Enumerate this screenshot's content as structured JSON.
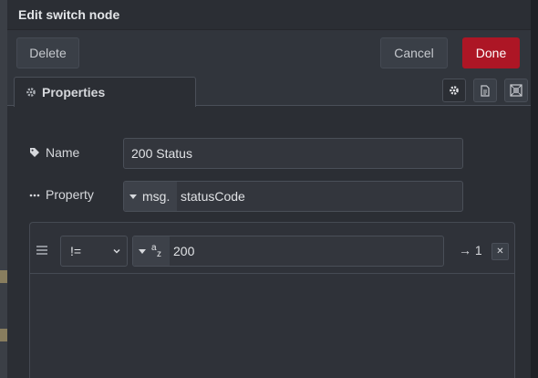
{
  "tray": {
    "title": "Edit switch node"
  },
  "toolbar": {
    "delete_label": "Delete",
    "cancel_label": "Cancel",
    "done_label": "Done"
  },
  "tabs": {
    "properties": {
      "label": "Properties",
      "icon": "gear-icon"
    },
    "icons": [
      "gear-icon",
      "document-icon",
      "frame-icon"
    ]
  },
  "form": {
    "name": {
      "label": "Name",
      "icon": "tag-icon",
      "value": "200 Status"
    },
    "property": {
      "label": "Property",
      "icon": "ellipsis-icon",
      "type": "msg.",
      "value": "statusCode"
    }
  },
  "rules": [
    {
      "operator": "!=",
      "value_type_icon": "string-az-icon",
      "value": "200",
      "output": "→ 1",
      "remove": "✕"
    }
  ],
  "colors": {
    "done": "#ad1625",
    "background": "#2b2e34"
  }
}
